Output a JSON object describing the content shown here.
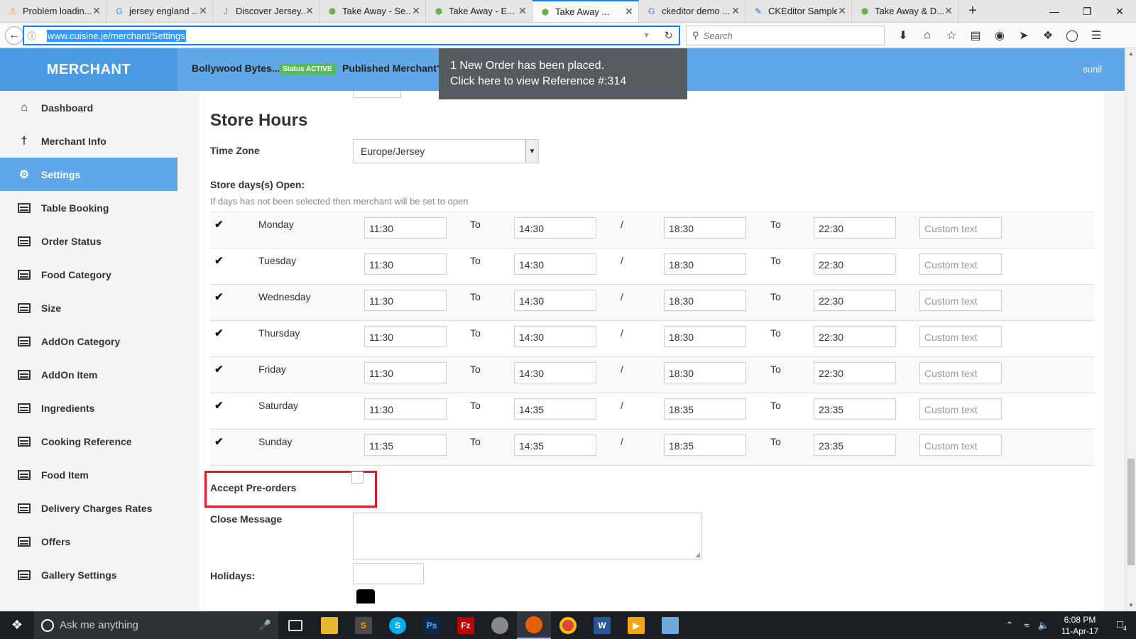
{
  "browser": {
    "tabs": [
      {
        "label": "Problem loadin...",
        "icon": "warning-icon",
        "active": false
      },
      {
        "label": "jersey england ...",
        "icon": "google-icon",
        "active": false
      },
      {
        "label": "Discover Jersey...",
        "icon": "jersey-logo-icon",
        "active": false
      },
      {
        "label": "Take Away - Se...",
        "icon": "cube-icon",
        "active": false
      },
      {
        "label": "Take Away - E...",
        "icon": "cube-icon",
        "active": false
      },
      {
        "label": "Take Away ...",
        "icon": "cube-icon",
        "active": true
      },
      {
        "label": "ckeditor demo ...",
        "icon": "google-icon",
        "active": false
      },
      {
        "label": "CKEditor Sample",
        "icon": "ckeditor-icon",
        "active": false
      },
      {
        "label": "Take Away & D...",
        "icon": "cube-icon",
        "active": false
      }
    ],
    "url": "www.cuisine.je/merchant/Settings",
    "search_placeholder": "Search"
  },
  "header": {
    "brand": "MERCHANT",
    "store_name": "Bollywood Bytes...",
    "status_badge": "Status ACTIVE",
    "published_label": "Published Merchant?",
    "user": "sunil",
    "accent_color": "#5fa7e8"
  },
  "notification": {
    "line1": "1 New Order has been placed.",
    "line2": "Click here to view Reference #:314"
  },
  "sidebar": {
    "items": [
      {
        "label": "Dashboard",
        "icon": "home-icon",
        "active": false
      },
      {
        "label": "Merchant Info",
        "icon": "cutlery-icon",
        "active": false
      },
      {
        "label": "Settings",
        "icon": "gear-icon",
        "active": true
      },
      {
        "label": "Table Booking",
        "icon": "list-icon",
        "active": false
      },
      {
        "label": "Order Status",
        "icon": "list-icon",
        "active": false
      },
      {
        "label": "Food Category",
        "icon": "list-icon",
        "active": false
      },
      {
        "label": "Size",
        "icon": "list-icon",
        "active": false
      },
      {
        "label": "AddOn Category",
        "icon": "list-icon",
        "active": false
      },
      {
        "label": "AddOn Item",
        "icon": "list-icon",
        "active": false
      },
      {
        "label": "Ingredients",
        "icon": "list-icon",
        "active": false
      },
      {
        "label": "Cooking Reference",
        "icon": "list-icon",
        "active": false
      },
      {
        "label": "Food Item",
        "icon": "list-icon",
        "active": false
      },
      {
        "label": "Delivery Charges Rates",
        "icon": "list-icon",
        "active": false
      },
      {
        "label": "Offers",
        "icon": "list-icon",
        "active": false
      },
      {
        "label": "Gallery Settings",
        "icon": "list-icon",
        "active": false
      }
    ]
  },
  "store_hours": {
    "heading": "Store Hours",
    "timezone_label": "Time Zone",
    "timezone_value": "Europe/Jersey",
    "days_label": "Store days(s) Open:",
    "hint": "If days has not been selected then merchant will be set to open",
    "to_label": "To",
    "slash": "/",
    "custom_placeholder": "Custom text",
    "days": [
      {
        "day": "Monday",
        "checked": true,
        "open1": "11:30",
        "close1": "14:30",
        "open2": "18:30",
        "close2": "22:30"
      },
      {
        "day": "Tuesday",
        "checked": true,
        "open1": "11:30",
        "close1": "14:30",
        "open2": "18:30",
        "close2": "22:30"
      },
      {
        "day": "Wednesday",
        "checked": true,
        "open1": "11:30",
        "close1": "14:30",
        "open2": "18:30",
        "close2": "22:30"
      },
      {
        "day": "Thursday",
        "checked": true,
        "open1": "11:30",
        "close1": "14:30",
        "open2": "18:30",
        "close2": "22:30"
      },
      {
        "day": "Friday",
        "checked": true,
        "open1": "11:30",
        "close1": "14:30",
        "open2": "18:30",
        "close2": "22:30"
      },
      {
        "day": "Saturday",
        "checked": true,
        "open1": "11:30",
        "close1": "14:35",
        "open2": "18:35",
        "close2": "23:35"
      },
      {
        "day": "Sunday",
        "checked": true,
        "open1": "11:35",
        "close1": "14:35",
        "open2": "18:35",
        "close2": "23:35"
      }
    ]
  },
  "form": {
    "preorder_label": "Accept Pre-orders",
    "preorder_checked": false,
    "close_message_label": "Close Message",
    "close_message_value": "",
    "holidays_label": "Holidays:",
    "highlight_color": "#e01b24"
  },
  "taskbar": {
    "search_placeholder": "Ask me anything",
    "time": "6:08 PM",
    "date": "11-Apr-17",
    "notification_count": "4"
  }
}
